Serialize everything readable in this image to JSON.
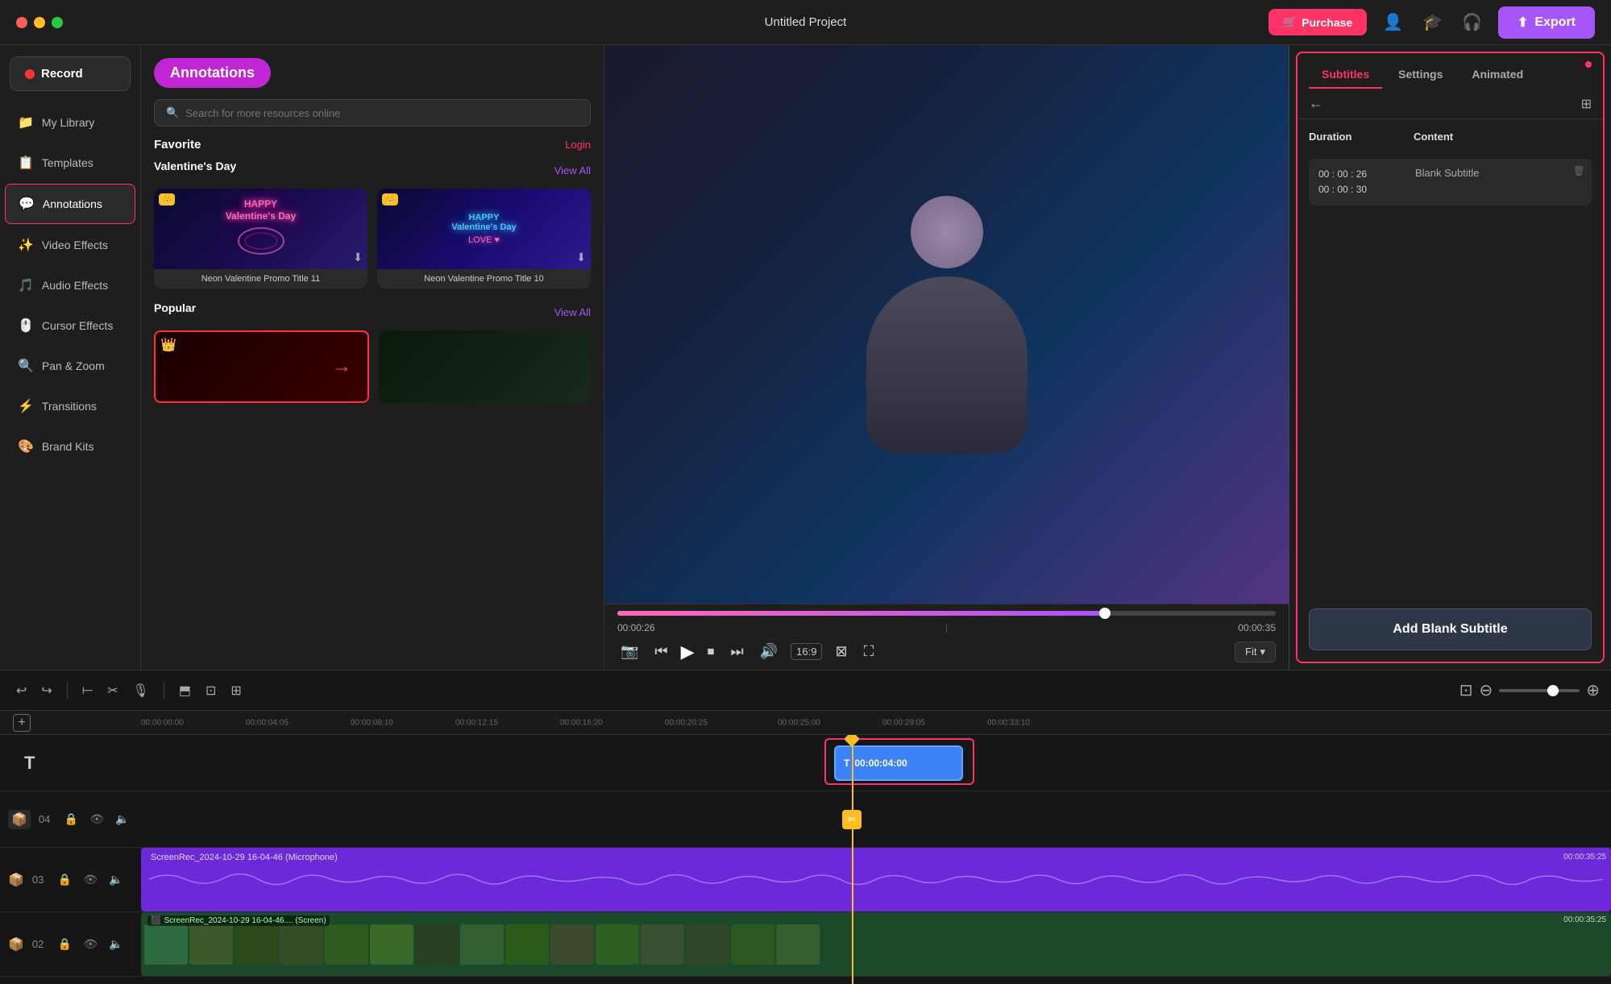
{
  "app": {
    "title": "Untitled Project",
    "traffic_lights": [
      "red",
      "yellow",
      "green"
    ]
  },
  "header": {
    "purchase_label": "Purchase",
    "export_label": "Export"
  },
  "sidebar": {
    "record_label": "Record",
    "items": [
      {
        "id": "my-library",
        "label": "My Library",
        "icon": "📁"
      },
      {
        "id": "templates",
        "label": "Templates",
        "icon": "📋"
      },
      {
        "id": "annotations",
        "label": "Annotations",
        "icon": "💬",
        "active": true
      },
      {
        "id": "video-effects",
        "label": "Video Effects",
        "icon": "✨"
      },
      {
        "id": "audio-effects",
        "label": "Audio Effects",
        "icon": "🎵"
      },
      {
        "id": "cursor-effects",
        "label": "Cursor Effects",
        "icon": "🖱️"
      },
      {
        "id": "pan-zoom",
        "label": "Pan & Zoom",
        "icon": "🔍"
      },
      {
        "id": "transitions",
        "label": "Transitions",
        "icon": "⚡"
      },
      {
        "id": "brand-kits",
        "label": "Brand Kits",
        "icon": "🎨"
      }
    ]
  },
  "annotations_panel": {
    "title": "Annotations",
    "search_placeholder": "Search for more resources online",
    "favorite_label": "Favorite",
    "login_label": "Login",
    "valentines_day_label": "Valentine's Day",
    "view_all_label": "View All",
    "popular_label": "Popular",
    "view_all_popular_label": "View All",
    "cards": [
      {
        "id": "card1",
        "label": "Neon Valentine Promo Title 11",
        "has_crown": true
      },
      {
        "id": "card2",
        "label": "Neon Valentine Promo Title 10",
        "has_crown": true
      }
    ],
    "popular_cards": [
      {
        "id": "pop1",
        "has_crown": true
      },
      {
        "id": "pop2",
        "has_crown": false
      }
    ]
  },
  "video_player": {
    "current_time": "00:00:26",
    "total_time": "00:00:35",
    "progress_pct": 74,
    "fit_label": "Fit"
  },
  "right_panel": {
    "tabs": [
      {
        "id": "subtitles",
        "label": "Subtitles",
        "active": true
      },
      {
        "id": "settings",
        "label": "Settings",
        "active": false
      },
      {
        "id": "animated",
        "label": "Animated",
        "active": false
      }
    ],
    "duration_col_label": "Duration",
    "content_col_label": "Content",
    "subtitle_row": {
      "start_time": "00 : 00 : 26",
      "end_time": "00 : 00 : 30",
      "content": "Blank Subtitle"
    },
    "add_blank_label": "Add Blank Subtitle"
  },
  "timeline": {
    "ruler_marks": [
      "00:00:00:00",
      "00:00:04:05",
      "00:00:08:10",
      "00:00:12:15",
      "00:00:16:20",
      "00:00:20:25",
      "00:00:25:00",
      "00:00:29:05",
      "00:00:33:10"
    ],
    "tracks": [
      {
        "id": "text-track",
        "type": "text",
        "label": "T",
        "clip_time": "00:00:04:00",
        "clip_start_pct": 58
      },
      {
        "id": "track-04",
        "type": "empty",
        "num": "04"
      },
      {
        "id": "track-03",
        "type": "audio",
        "num": "03",
        "label": "ScreenRec_2024-10-29 16-04-46 (Microphone)",
        "end_time": "00:00:35:25"
      },
      {
        "id": "track-02",
        "type": "video",
        "num": "02",
        "label": "ScreenRec_2024-10-29 16-04-46.... (Screen)",
        "end_time": "00:00:35:25"
      }
    ],
    "playhead_pct": 58,
    "playhead_time": "00:00:25"
  }
}
